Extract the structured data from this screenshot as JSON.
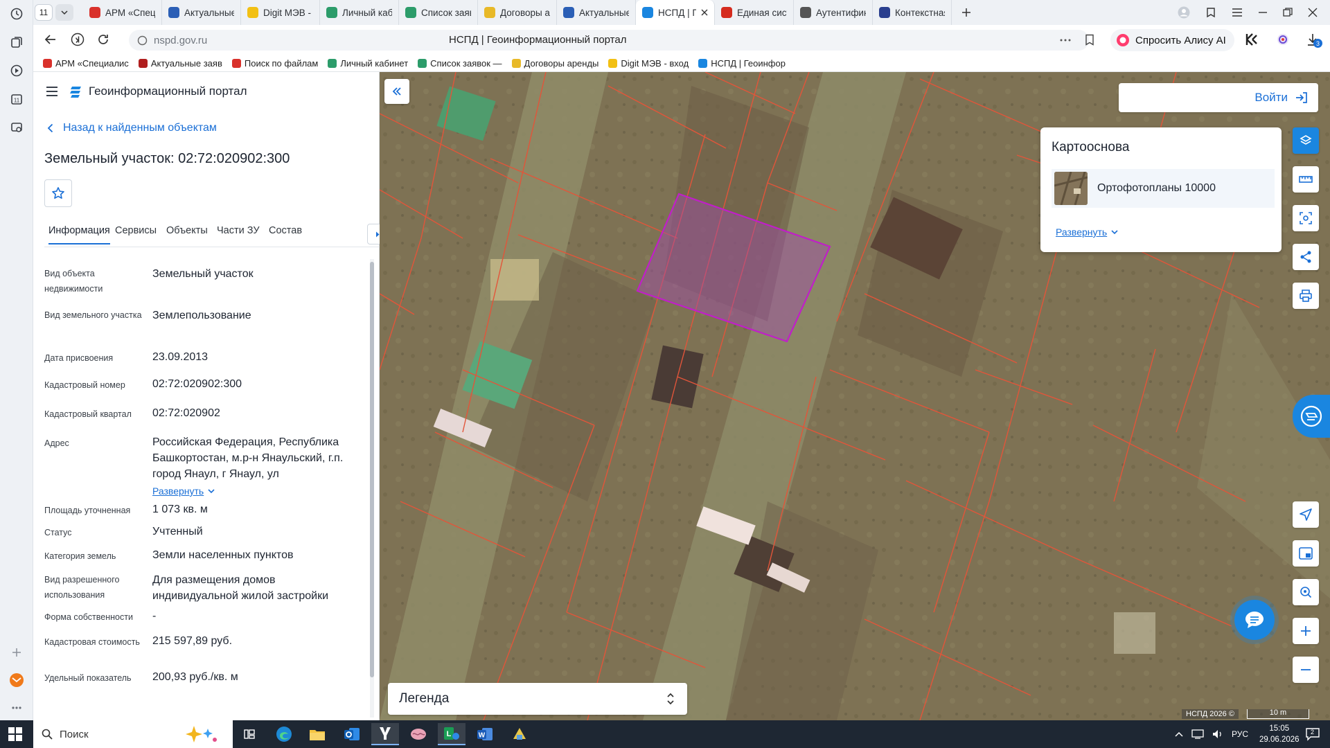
{
  "browser": {
    "tab_count": "11",
    "tabs": [
      {
        "label": "АРМ «Специал",
        "icon": "arm-favicon",
        "color": "#d9312b"
      },
      {
        "label": "Актуальные за",
        "icon": "document-favicon",
        "color": "#2b5fb6"
      },
      {
        "label": "Digit МЭВ - нач",
        "icon": "digit-favicon",
        "color": "#f2c014"
      },
      {
        "label": "Личный кабин",
        "icon": "cabinet-favicon",
        "color": "#2c9c6a"
      },
      {
        "label": "Список заявок",
        "icon": "m-favicon",
        "color": "#2c9c6a"
      },
      {
        "label": "Договоры арен",
        "icon": "contracts-favicon",
        "color": "#e8b928"
      },
      {
        "label": "Актуальные за",
        "icon": "document-favicon",
        "color": "#2b5fb6"
      },
      {
        "label": "НСПД | Геои",
        "icon": "nspd-favicon",
        "color": "#1a86e0",
        "active": true
      },
      {
        "label": "Единая систем",
        "icon": "flag-favicon",
        "color": "#d52b1e"
      },
      {
        "label": "Аутентификац",
        "icon": "g-favicon",
        "color": "#555555"
      },
      {
        "label": "Контекстная А",
        "icon": "y-favicon",
        "color": "#2a3f8f"
      }
    ],
    "url": "nspd.gov.ru",
    "page_title": "НСПД | Геоинформационный портал",
    "alice_label": "Спросить Алису AI",
    "downloads_badge": "3",
    "bookmarks": [
      {
        "label": "АРМ «Специалис",
        "color": "#d9312b"
      },
      {
        "label": "Актуальные заяв",
        "color": "#b01e1e"
      },
      {
        "label": "Поиск по файлам",
        "color": "#d9312b"
      },
      {
        "label": "Личный кабинет",
        "color": "#2c9c6a"
      },
      {
        "label": "Список заявок —",
        "color": "#2c9c6a"
      },
      {
        "label": "Договоры аренды",
        "color": "#e8b928"
      },
      {
        "label": "Digit МЭВ - вход",
        "color": "#f2c014"
      },
      {
        "label": "НСПД | Геоинфор",
        "color": "#1a86e0"
      }
    ]
  },
  "portal": {
    "name": "Геоинформационный портал",
    "back_link": "Назад к найденным объектам",
    "object_title": "Земельный участок: 02:72:020902:300",
    "tabs": [
      "Информация",
      "Сервисы",
      "Объекты",
      "Части ЗУ",
      "Состав"
    ],
    "fields": [
      {
        "label": "Вид объекта недвижимости",
        "value": "Земельный участок"
      },
      {
        "label": "Вид земельного участка",
        "value": "Землепользование"
      },
      {
        "label": "Дата присвоения",
        "value": "23.09.2013"
      },
      {
        "label": "Кадастровый номер",
        "value": "02:72:020902:300"
      },
      {
        "label": "Кадастровый квартал",
        "value": "02:72:020902"
      },
      {
        "label": "Адрес",
        "value": "Российская Федерация, Республика Башкортостан, м.р-н Янаульский, г.п. город Янаул, г Янаул, ул"
      },
      {
        "label": "Площадь уточненная",
        "value": "1 073 кв. м"
      },
      {
        "label": "Статус",
        "value": "Учтенный"
      },
      {
        "label": "Категория земель",
        "value": "Земли населенных пунктов"
      },
      {
        "label": "Вид разрешенного использования",
        "value": "Для размещения домов индивидуальной жилой застройки"
      },
      {
        "label": "Форма собственности",
        "value": "-"
      },
      {
        "label": "Кадастровая стоимость",
        "value": "215 597,89 руб."
      },
      {
        "label": "Удельный показатель",
        "value": "200,93 руб./кв. м"
      }
    ],
    "address_expand": "Развернуть"
  },
  "map": {
    "login_label": "Войти",
    "basemap_title": "Картооснова",
    "basemap_item": "Ортофотопланы 10000",
    "basemap_expand": "Развернуть",
    "legend_label": "Легенда",
    "copyright": "НСПД 2026 ©",
    "scale_label": "10 m",
    "parcel_color": "#c01fc8",
    "boundary_color": "#e2553a"
  },
  "taskbar": {
    "search_placeholder": "Поиск",
    "language": "РУС",
    "time": "15:05",
    "date": "29.06.2026",
    "notification_count": "2"
  }
}
